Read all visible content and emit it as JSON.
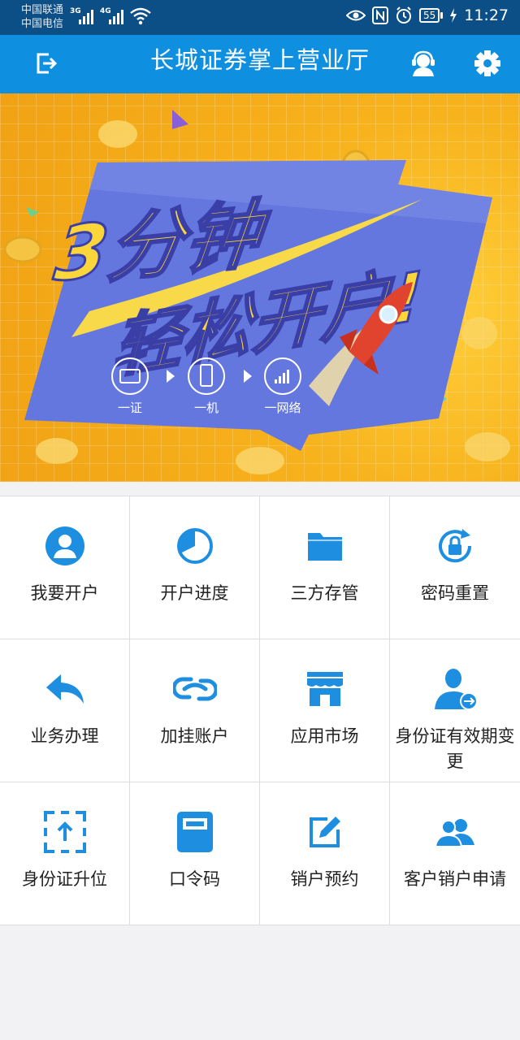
{
  "status_bar": {
    "carrier1": "中国联通",
    "carrier2": "中国电信",
    "net1": "3G",
    "net2": "4G",
    "battery": "55",
    "time": "11:27"
  },
  "header": {
    "title": "长城证券掌上营业厅"
  },
  "banner": {
    "headline_line1": "3分钟",
    "headline_line2": "轻松开户!",
    "steps": [
      "一证",
      "一机",
      "一网络"
    ]
  },
  "grid": {
    "items": [
      {
        "label": "我要开户",
        "icon": "user-icon"
      },
      {
        "label": "开户进度",
        "icon": "progress-pie-icon"
      },
      {
        "label": "三方存管",
        "icon": "folder-icon"
      },
      {
        "label": "密码重置",
        "icon": "lock-reset-icon"
      },
      {
        "label": "业务办理",
        "icon": "reply-arrow-icon"
      },
      {
        "label": "加挂账户",
        "icon": "link-icon"
      },
      {
        "label": "应用市场",
        "icon": "store-icon"
      },
      {
        "label": "身份证有效期变更",
        "icon": "user-transfer-icon"
      },
      {
        "label": "身份证升位",
        "icon": "upload-frame-icon"
      },
      {
        "label": "口令码",
        "icon": "token-device-icon"
      },
      {
        "label": "销户预约",
        "icon": "edit-icon"
      },
      {
        "label": "客户销户申请",
        "icon": "users-icon"
      }
    ]
  },
  "colors": {
    "status_bar": "#0b4f86",
    "header": "#0f8fe0",
    "icon_blue": "#1e8fe0",
    "banner_yellow": "#f7b21c",
    "banner_panel": "#6a7fe0"
  }
}
